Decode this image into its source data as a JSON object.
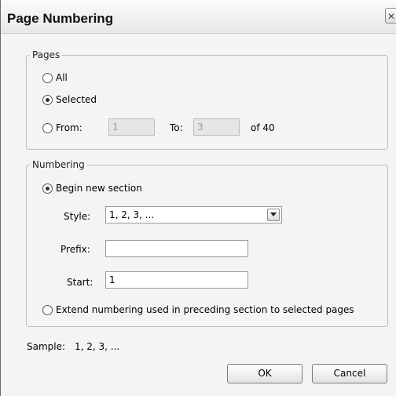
{
  "dialog": {
    "title": "Page Numbering",
    "close_icon": "close-icon"
  },
  "pages": {
    "legend": "Pages",
    "all_label": "All",
    "selected_label": "Selected",
    "from_label": "From:",
    "from_value": "1",
    "to_label": "To:",
    "to_value": "3",
    "of_label": "of 40",
    "selected_option": "Selected"
  },
  "numbering": {
    "legend": "Numbering",
    "begin_label": "Begin new section",
    "style_label": "Style:",
    "style_value": "1, 2, 3, ...",
    "prefix_label": "Prefix:",
    "prefix_value": "",
    "start_label": "Start:",
    "start_value": "1",
    "extend_label": "Extend numbering used in preceding section to selected pages",
    "selected_option": "Begin new section"
  },
  "sample": {
    "label": "Sample:",
    "value": "1, 2, 3, ..."
  },
  "buttons": {
    "ok": "OK",
    "cancel": "Cancel"
  }
}
